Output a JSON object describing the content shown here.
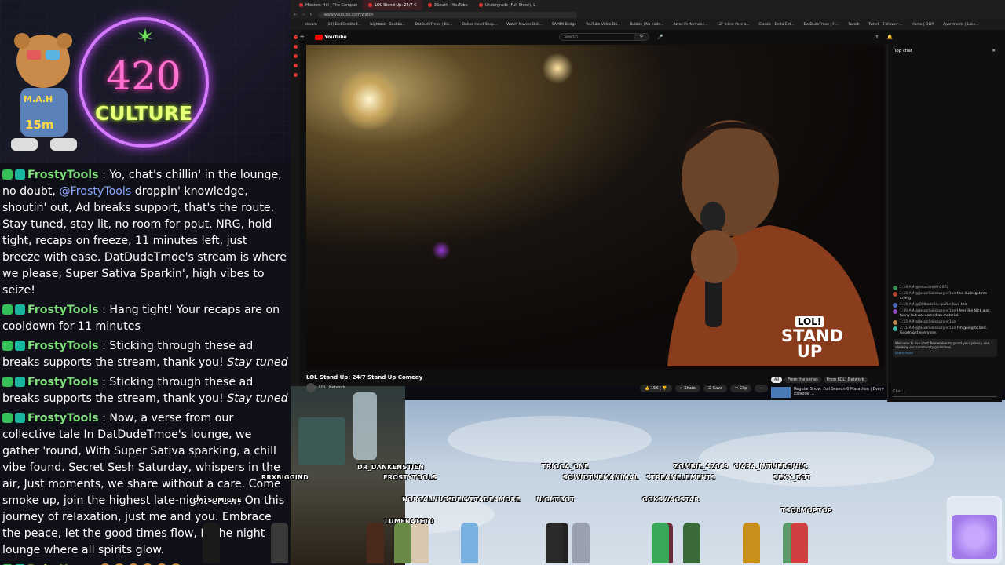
{
  "overlay": {
    "culture_top": "420",
    "culture_bottom": "CULTURE",
    "bear_timer": "15m",
    "bear_shirt": "M.A.H"
  },
  "chat": {
    "messages": [
      {
        "user": "FrostyTools",
        "parts": [
          " : Yo, chat's chillin' in the lounge, no doubt, ",
          "@FrostyTools",
          " droppin' knowledge, shoutin' out, Ad breaks support, that's the route, Stay tuned, stay lit, no room for pout. NRG, hold tight, recaps on freeze, 11 minutes left, just breeze with ease. DatDudeTmoe's stream is where we please, Super Sativa Sparkin', high vibes to seize!"
        ]
      },
      {
        "user": "FrostyTools",
        "parts": [
          " : Hang tight! Your recaps are on cooldown for 11 minutes"
        ]
      },
      {
        "user": "FrostyTools",
        "parts": [
          " : Sticking through these ad breaks supports the stream, thank you! ",
          "Stay tuned"
        ]
      },
      {
        "user": "FrostyTools",
        "parts": [
          " : Sticking through these ad breaks supports the stream, thank you! ",
          "Stay tuned"
        ]
      },
      {
        "user": "FrostyTools",
        "parts": [
          " : Now, a verse from our collective tale In DatDudeTmoe's lounge, we gather 'round, With Super Sativa sparking, a chill vibe found. Secret Sesh Saturday, whispers in the air, Just moments, we share without a care. Come smoke up, join the highest late-night crew, On this journey of relaxation, just me and you. Embrace the peace, let the good times flow, In the night lounge where all spirits glow."
        ]
      },
      {
        "user": "BabeHype",
        "parts": [
          " :"
        ]
      }
    ]
  },
  "browser": {
    "tabs": [
      "Mission: Hill | The Compan",
      "LOL Stand Up: 24/7 C",
      "3South - YouTube",
      "Undergrads (Full Show), L"
    ],
    "url": "www.youtube.com/watch",
    "bookmarks": [
      "stream",
      "[10] End Credits f...",
      "Nightbot - Dashbo...",
      "DatDudeTmoe | Kic...",
      "Online Head Shop...",
      "Watch Movies Onli...",
      "SAMMI Bridge",
      "YouTube Video Do...",
      "Bubble | No-code...",
      "Aztec Performanc...",
      "12\" Inline Perc b...",
      "Classic - Delta Ext...",
      "DatDudeTmoe | Fr...",
      "Twitch",
      "Twitch - Follower-...",
      "Home | OLIP",
      "Apartments | Lake..."
    ]
  },
  "youtube": {
    "logo": "YouTube",
    "search_placeholder": "Search",
    "video_title": "LOL Stand Up: 24/7 Stand Up Comedy",
    "channel": "LOL! Network",
    "likes": "15K",
    "share": "Share",
    "save": "Save",
    "clip": "Clip",
    "badge_top": "LOL!",
    "badge_bottom": "STAND UP",
    "chat_title": "Top chat",
    "chat_messages": [
      {
        "time": "1:14 AM",
        "user": "@robertsmith2072",
        "text": ""
      },
      {
        "time": "1:15 AM",
        "user": "@JasonSalisbury-sr1an",
        "text": "this dude got me crying"
      },
      {
        "time": "1:16 AM",
        "user": "@OldballsBlu-qu7be",
        "text": "love this"
      },
      {
        "time": "1:40 AM",
        "user": "@JasonSalisbury-sr1an",
        "text": "I feel like Nick was funny but not comedian material."
      },
      {
        "time": "1:55 AM",
        "user": "@JasonSalisbury-sr1an",
        "text": ""
      },
      {
        "time": "2:11 AM",
        "user": "@JasonSalisbury-sr1an",
        "text": "I'm going to bed. Goodnight everyone."
      }
    ],
    "chat_notice": "Welcome to live chat! Remember to guard your privacy and abide by our community guidelines.",
    "learn_more": "Learn more",
    "chat_input": "Chat...",
    "chips": [
      "All",
      "From the series",
      "From LOL! Network"
    ],
    "related_title": "Regular Show: Full Season 6 Marathon | Every Episode ..."
  },
  "stream": {
    "names": [
      "DR_DANKENSTIEN",
      "FROSTYTOOLS",
      "NORCALNUGS",
      "LUMENATETU",
      "RRXBIGGIND",
      "OATSUMICHE",
      "DELVETADEAMORE",
      "TRIGGA_ONE",
      "SOWIDTHEMANIMAL",
      "NIGHTBOT",
      "ZOMBIE_42069",
      "STREAMELEMENTS",
      "CIARA_INTHEBONUS",
      "SEXY_BOT",
      "GGKSWAGSTAR",
      "TSOLMOPTOP"
    ]
  }
}
